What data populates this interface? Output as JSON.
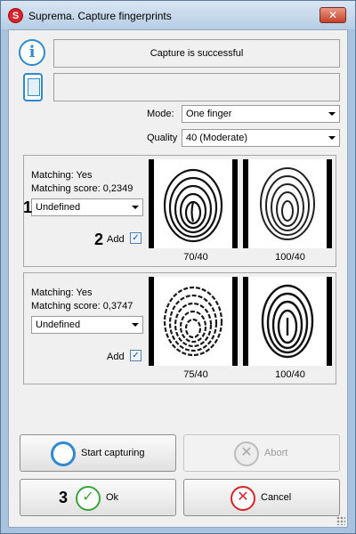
{
  "window": {
    "title": "Suprema. Capture fingerprints",
    "app_icon_letter": "S",
    "close_glyph": "✕"
  },
  "status": {
    "message": "Capture is successful",
    "device_text": ""
  },
  "settings": {
    "mode_label": "Mode:",
    "mode_value": "One finger",
    "quality_label": "Quality",
    "quality_value": "40 (Moderate)"
  },
  "groups": [
    {
      "matching": "Matching: Yes",
      "score": "Matching score: 0,2349",
      "finger": "Undefined",
      "add_label": "Add",
      "add_checked": true,
      "scores": [
        "70/40",
        "100/40"
      ]
    },
    {
      "matching": "Matching: Yes",
      "score": "Matching score: 0,3747",
      "finger": "Undefined",
      "add_label": "Add",
      "add_checked": true,
      "scores": [
        "75/40",
        "100/40"
      ]
    }
  ],
  "callouts": [
    "1",
    "2",
    "3"
  ],
  "buttons": {
    "start": "Start capturing",
    "abort": "Abort",
    "ok": "Ok",
    "cancel": "Cancel"
  },
  "icons": {
    "app": "suprema-logo-icon",
    "info": "info-icon",
    "device": "device-icon",
    "search": "magnifier-icon",
    "abort": "abort-x-icon",
    "ok": "check-icon",
    "cancel": "cancel-x-icon"
  },
  "colors": {
    "accent_blue": "#2f8ad0",
    "ok_green": "#3aa63a",
    "cancel_red": "#d8242a"
  }
}
